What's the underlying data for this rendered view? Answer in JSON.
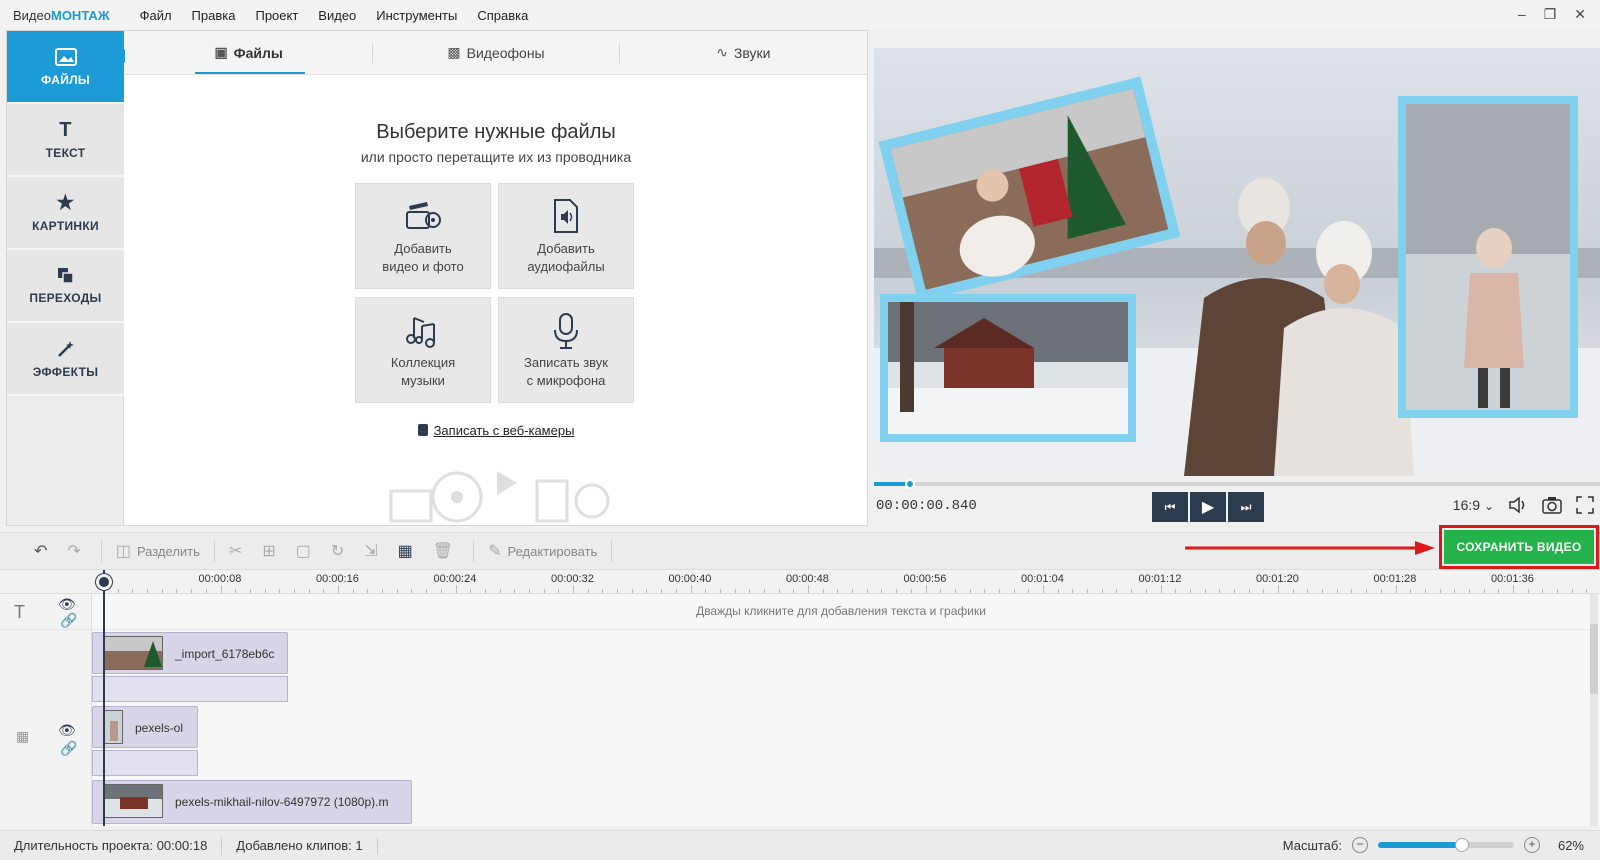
{
  "app": {
    "brand_part1": "Видео",
    "brand_part2": "МОНТАЖ"
  },
  "menu": [
    "Файл",
    "Правка",
    "Проект",
    "Видео",
    "Инструменты",
    "Справка"
  ],
  "sidebar": {
    "items": [
      {
        "label": "ФАЙЛЫ",
        "icon": "files-icon",
        "active": true
      },
      {
        "label": "ТЕКСТ",
        "icon": "text-icon",
        "active": false
      },
      {
        "label": "КАРТИНКИ",
        "icon": "star-icon",
        "active": false
      },
      {
        "label": "ПЕРЕХОДЫ",
        "icon": "transitions-icon",
        "active": false
      },
      {
        "label": "ЭФФЕКТЫ",
        "icon": "magic-wand-icon",
        "active": false
      }
    ]
  },
  "tabs": [
    {
      "label": "Файлы",
      "icon": "image-icon",
      "active": true
    },
    {
      "label": "Видеофоны",
      "icon": "video-background-icon",
      "active": false
    },
    {
      "label": "Звуки",
      "icon": "soundwave-icon",
      "active": false
    }
  ],
  "files_panel": {
    "title": "Выберите нужные файлы",
    "subtitle": "или просто перетащите их из проводника",
    "tiles": [
      {
        "label": "Добавить\nвидео и фото",
        "icon": "film-camera-icon"
      },
      {
        "label": "Добавить\nаудиофайлы",
        "icon": "audio-file-icon"
      },
      {
        "label": "Коллекция\nмузыки",
        "icon": "music-notes-icon"
      },
      {
        "label": "Записать звук\nс микрофона",
        "icon": "microphone-icon"
      }
    ],
    "webcam_link": "Записать с веб-камеры"
  },
  "preview": {
    "timecode": "00:00:00.840",
    "progress_fraction": 0.05,
    "aspect_ratio": "16:9",
    "aspect_chevron": "⌄"
  },
  "toolbar": {
    "split_label": "Разделить",
    "edit_label": "Редактировать",
    "save_label": "СОХРАНИТЬ ВИДЕО"
  },
  "timeline": {
    "ticks": [
      "00:00:08",
      "00:00:16",
      "00:00:24",
      "00:00:32",
      "00:00:40",
      "00:00:48",
      "00:00:56",
      "00:01:04",
      "00:01:12",
      "00:01:20",
      "00:01:28",
      "00:01:36"
    ],
    "text_hint": "Дважды кликните для добавления текста и графики",
    "clips": [
      {
        "label": "_import_6178eb6c"
      },
      {
        "label": "pexels-ol"
      },
      {
        "label": "pexels-mikhail-nilov-6497972 (1080p).m"
      }
    ]
  },
  "status": {
    "duration": "Длительность проекта:  00:00:18",
    "clips_added": "Добавлено клипов: 1",
    "zoom_label": "Масштаб:",
    "zoom_value": "62%",
    "zoom_fraction": 0.62
  },
  "colors": {
    "accent": "#1d9bd7",
    "save_green": "#24b34a",
    "highlight_red": "#e01818",
    "nav_dark": "#2d3b4f"
  }
}
